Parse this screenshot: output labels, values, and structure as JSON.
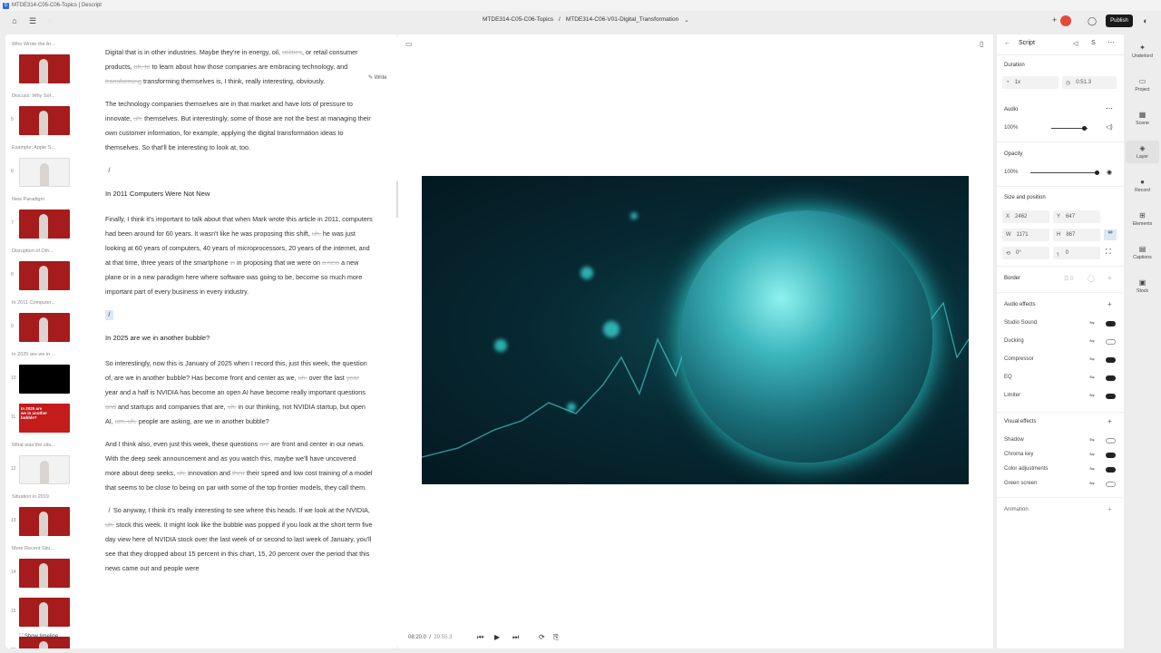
{
  "window": {
    "title": "MTDE314-C05-C06-Topics | Descript"
  },
  "header": {
    "project": "MTDE314-C05-C06-Topics",
    "separator": "/",
    "composition": "MTDE314-C06-V01-Digital_Transformation",
    "publish_label": "Publish"
  },
  "write_label": "Write",
  "scenes": [
    {
      "num": "",
      "label": "Who Wrote the Ar...",
      "thumb": "red"
    },
    {
      "num": "5",
      "label": "Discuss: Why Sof...",
      "thumb": "red"
    },
    {
      "num": "6",
      "label": "Example: Apple S...",
      "thumb": "white"
    },
    {
      "num": "7",
      "label": "New Paradigm",
      "thumb": "red"
    },
    {
      "num": "8",
      "label": "Disruption of Oth...",
      "thumb": "red"
    },
    {
      "num": "9",
      "label": "In 2011 Computer...",
      "thumb": "red"
    },
    {
      "num": "10",
      "label": "In 2025 are we in ...",
      "thumb": "black"
    },
    {
      "num": "11",
      "label": "",
      "thumb": "slide",
      "slide_text": "In 2025 are we in another bubble?"
    },
    {
      "num": "12",
      "label": "What was the situ...",
      "thumb": "white"
    },
    {
      "num": "13",
      "label": "Situation in 2019",
      "thumb": "red"
    },
    {
      "num": "14",
      "label": "More Recent Situ...",
      "thumb": "red"
    },
    {
      "num": "15",
      "label": "",
      "thumb": "red"
    },
    {
      "num": "16",
      "label": "",
      "thumb": "red"
    }
  ],
  "script": {
    "p1a": "Digital that is in other industries. Maybe they're in energy, oil, ",
    "p1f1": "utilities",
    "p1b": ", or retail consumer products, ",
    "p1f2": "uh, to",
    "p1c": " to learn about how those companies are embracing technology, and ",
    "p1f3": "transforming",
    "p1d": " transforming themselves is, I think, really interesting, obviously.",
    "p2a": "The technology companies themselves are in that market and have lots of pressure to innovate, ",
    "p2f1": "uh,",
    "p2b": " themselves. But interestingly, some of those are not the best at managing their own customer information, for example, applying the digital transformation ideas to themselves. So that'll be interesting to look at, too.",
    "h1": "In 2011 Computers Were Not New",
    "p3a": "Finally,  I think it's important to talk about that when Mark wrote this article in 2011, computers had been around for 60 years. It wasn't like he was proposing this shift, ",
    "p3f1": "uh,",
    "p3b": " he was just looking at 60 years of computers, 40 years of microprocessors, 20 years of the internet, and at that time, three years of the smartphone ",
    "p3f2": "in",
    "p3c": " in proposing that we were on ",
    "p3f3": "a new",
    "p3d": " a new plane or in a new paradigm here where software was going to be, become so much more important part of every business in every industry.",
    "h2": "In 2025 are we in another bubble?",
    "p4a": "So interestingly, now this is January of 2025 when I record this, just this week, the question of, are we in another bubble? Has become front and center as we, ",
    "p4f1": "uh,",
    "p4b": " over the last ",
    "p4f2": "year",
    "p4c": " year and a half is NVIDIA has become an open AI have become really important questions ",
    "p4f3": "and",
    "p4d": " and startups and companies that are, ",
    "p4f4": "uh,",
    "p4e": " in our thinking, not NVIDIA startup, but open AI, ",
    "p4f5": "um, uh,",
    "p4g": " people are asking, are we in another bubble?",
    "p5a": "And I think also, even just this week, these questions ",
    "p5f1": "are",
    "p5b": " are front and center in our news. With the deep seek announcement and as you watch this, maybe we'll have uncovered more about deep seeks, ",
    "p5f2": "uh,",
    "p5c": " innovation and ",
    "p5f3": "their",
    "p5d": " their speed and low cost training of a model that seems to be close to being on par with some of the top frontier models, they call them.",
    "p6a": "So anyway, I think it's really interesting to see where this heads. If we look at the  NVIDIA, ",
    "p6f1": "uh,",
    "p6b": " stock this week.   It might look like the bubble was popped if you look at the short term five day view here of NVIDIA stock over the last week of or second to last week of January, you'll see that they dropped about 15 percent in this chart, 15, 20 percent over the period that this news came out and people were",
    "slash": "/"
  },
  "properties": {
    "title": "Script",
    "duration_label": "Duration",
    "speed": "1x",
    "duration": "0:51.3",
    "audio_label": "Audio",
    "audio_volume": "100%",
    "audio_level": 0.9,
    "opacity_label": "Opacity",
    "opacity_value": "100%",
    "opacity_level": 1.0,
    "size_label": "Size and position",
    "x_label": "X",
    "x_value": "2462",
    "y_label": "Y",
    "y_value": "647",
    "w_label": "W",
    "w_value": "1171",
    "h_label": "H",
    "h_value": "867",
    "rotation": "0°",
    "corner": "0",
    "border_label": "Border",
    "border_value": "0",
    "audio_effects_label": "Audio effects",
    "audio_effects": [
      {
        "name": "Studio Sound",
        "on": true
      },
      {
        "name": "Ducking",
        "on": false
      },
      {
        "name": "Compressor",
        "on": true
      },
      {
        "name": "EQ",
        "on": true
      },
      {
        "name": "Limiter",
        "on": true
      }
    ],
    "visual_effects_label": "Visual effects",
    "visual_effects": [
      {
        "name": "Shadow",
        "on": false
      },
      {
        "name": "Chroma key",
        "on": true
      },
      {
        "name": "Color adjustments",
        "on": true
      },
      {
        "name": "Green screen",
        "on": false
      }
    ],
    "animation_label": "Animation"
  },
  "right_sidebar": [
    "Underlord",
    "Project",
    "Scene",
    "Layer",
    "Record",
    "Elements",
    "Captions",
    "Stock"
  ],
  "timeline": {
    "show_label": "Show timeline",
    "current": "08:20.0",
    "divider": "/",
    "total": "39:55.3"
  }
}
